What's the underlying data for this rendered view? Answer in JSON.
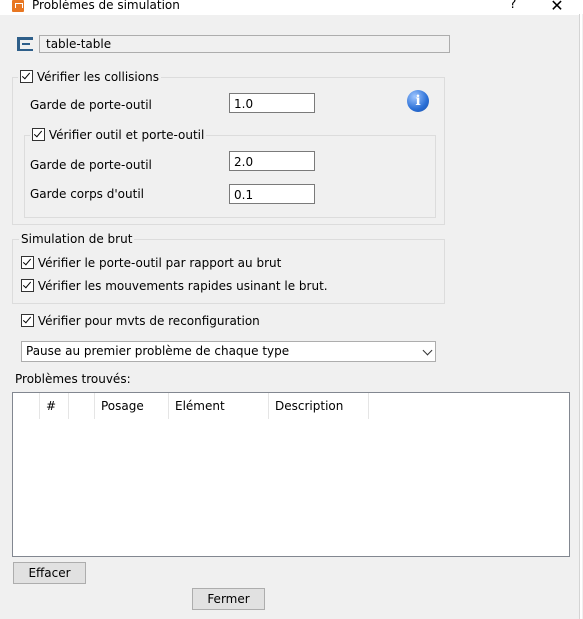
{
  "window": {
    "title": "Problèmes de simulation",
    "help_label": "?",
    "close_label": "✕"
  },
  "machine": {
    "value": "table-table",
    "icon": "machine-icon"
  },
  "collisions": {
    "label": "Vérifier les collisions",
    "checked": true,
    "garde_porte_outil_label": "Garde de porte-outil",
    "garde_porte_outil_value": "1.0",
    "info_icon": "info-icon",
    "tool_group": {
      "label": "Vérifier outil et porte-outil",
      "checked": true,
      "garde_porte_outil_label": "Garde de porte-outil",
      "garde_porte_outil_value": "2.0",
      "garde_corps_label": "Garde corps d'outil",
      "garde_corps_value": "0.1"
    }
  },
  "stock_sim": {
    "label": "Simulation de brut",
    "check1": "Vérifier le porte-outil par rapport au brut",
    "check2": "Vérifier les mouvements rapides usinant le brut."
  },
  "reconfig": {
    "label": "Vérifier pour mvts de reconfiguration",
    "checked": true
  },
  "pause_select": {
    "value": "Pause au premier problème de chaque type"
  },
  "problems": {
    "label": "Problèmes trouvés:",
    "columns": [
      "",
      "#",
      "",
      "Posage",
      "Elément",
      "Description"
    ],
    "rows": []
  },
  "buttons": {
    "clear": "Effacer",
    "close": "Fermer"
  }
}
